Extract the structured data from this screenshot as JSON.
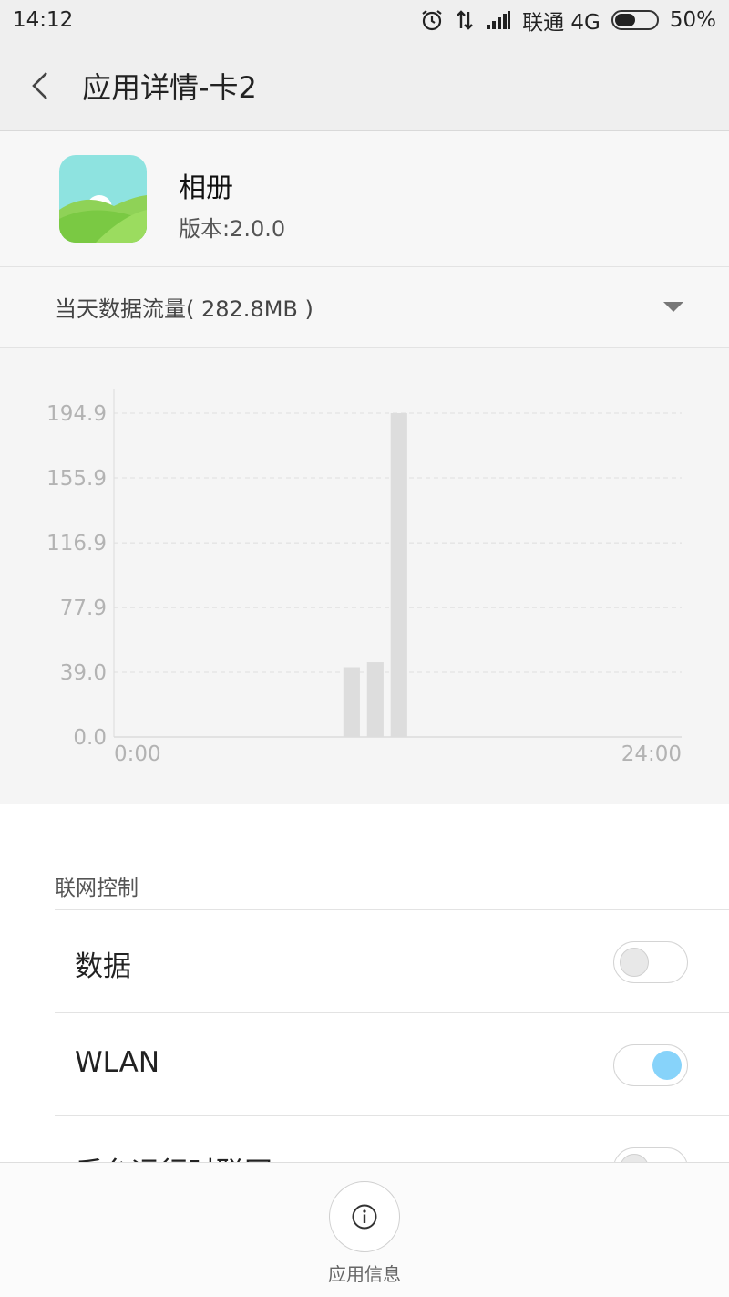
{
  "status_bar": {
    "time": "14:12",
    "carrier": "联通 4G",
    "battery": "50%",
    "battery_level": 0.5,
    "icons": [
      "alarm-icon",
      "data-arrows-icon",
      "signal-icon",
      "battery-icon"
    ]
  },
  "header": {
    "title": "应用详情-卡2",
    "back_icon": "chevron-left-icon"
  },
  "app": {
    "name": "相册",
    "version": "版本:2.0.0",
    "icon": "gallery-app-icon"
  },
  "usage": {
    "label": "当天数据流量( 282.8MB )",
    "dropdown_icon": "triangle-down-icon"
  },
  "chart_data": {
    "type": "bar",
    "yticks": [
      "194.9",
      "155.9",
      "116.9",
      "77.9",
      "39.0",
      "0.0"
    ],
    "ylim": [
      0,
      194.9
    ],
    "xlim": [
      0,
      24
    ],
    "x_tick_labels": [
      "0:00",
      "24:00"
    ],
    "bars": [
      {
        "hour": 10,
        "value": 42
      },
      {
        "hour": 11,
        "value": 45
      },
      {
        "hour": 12,
        "value": 194.9
      }
    ],
    "grid": true
  },
  "network": {
    "section_title": "联网控制",
    "rows": [
      {
        "label": "数据",
        "enabled": false
      },
      {
        "label": "WLAN",
        "enabled": true
      },
      {
        "label": "后台运行时联网",
        "enabled": false
      }
    ]
  },
  "bottom": {
    "info_label": "应用信息",
    "info_icon": "info-circle-icon"
  },
  "colors": {
    "accent_toggle": "#87d3fa",
    "bar": "#dddddd"
  }
}
